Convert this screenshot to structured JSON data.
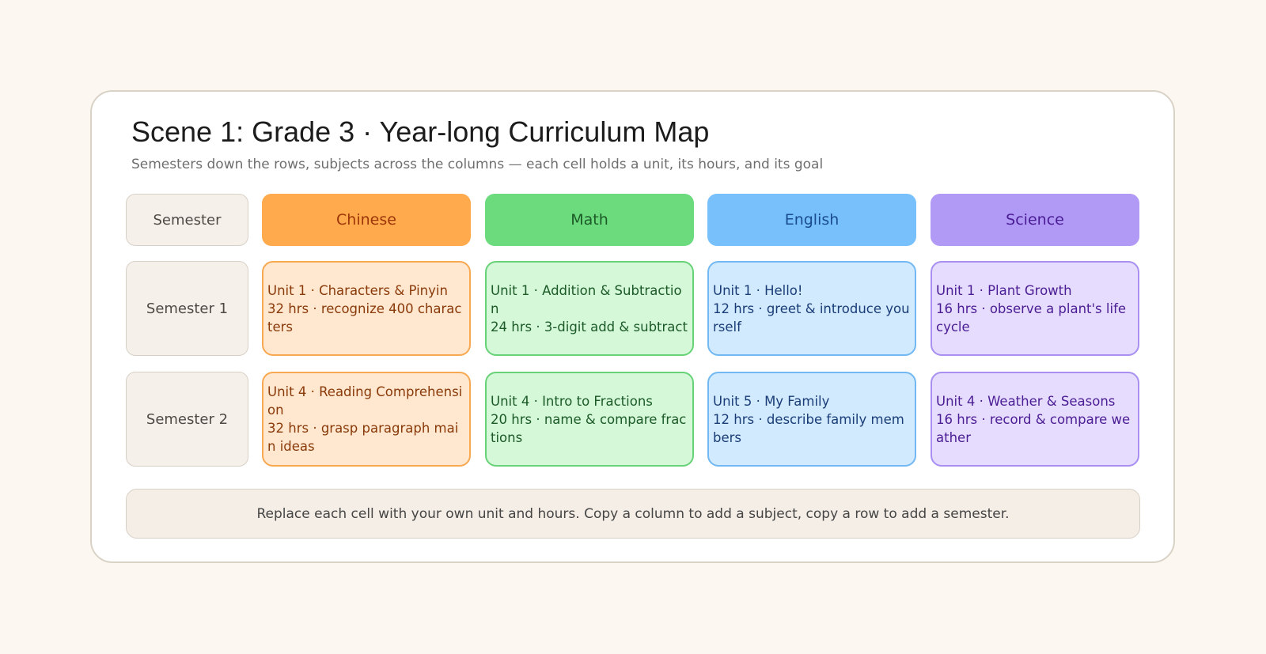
{
  "title": "Scene 1: Grade 3 · Year-long Curriculum Map",
  "subtitle": "Semesters down the rows, subjects across the columns — each cell holds a unit, its hours, and its goal",
  "corner_label": "Semester",
  "subjects": [
    {
      "name": "Chinese",
      "header_bg": "#ffaa4d",
      "header_text": "#9c3508",
      "cell_bg": "#ffe8cf",
      "cell_border": "#f7a851",
      "cell_text": "#8a3a0a"
    },
    {
      "name": "Math",
      "header_bg": "#6bdb7e",
      "header_text": "#1c5a27",
      "cell_bg": "#d5f8d9",
      "cell_border": "#67d277",
      "cell_text": "#1c5a27"
    },
    {
      "name": "English",
      "header_bg": "#78c0fb",
      "header_text": "#1a4d8f",
      "cell_bg": "#d2eafd",
      "cell_border": "#72b8f3",
      "cell_text": "#1a3d78"
    },
    {
      "name": "Science",
      "header_bg": "#b199f6",
      "header_text": "#4a1d94",
      "cell_bg": "#e6dcfd",
      "cell_border": "#a88ff0",
      "cell_text": "#4a1d94"
    }
  ],
  "semesters": [
    {
      "label": "Semester 1",
      "cells": [
        {
          "unit": "Unit 1 · Characters & Pinyin",
          "detail": "32 hrs · recognize 400 characters"
        },
        {
          "unit": "Unit 1 · Addition & Subtraction",
          "detail": "24 hrs · 3-digit add & subtract"
        },
        {
          "unit": "Unit 1 · Hello!",
          "detail": "12 hrs · greet & introduce yourself"
        },
        {
          "unit": "Unit 1 · Plant Growth",
          "detail": "16 hrs · observe a plant's life cycle"
        }
      ]
    },
    {
      "label": "Semester 2",
      "cells": [
        {
          "unit": "Unit 4 · Reading Comprehension",
          "detail": "32 hrs · grasp paragraph main ideas"
        },
        {
          "unit": "Unit 4 · Intro to Fractions",
          "detail": "20 hrs · name & compare fractions"
        },
        {
          "unit": "Unit 5 · My Family",
          "detail": "12 hrs · describe family members"
        },
        {
          "unit": "Unit 4 · Weather & Seasons",
          "detail": "16 hrs · record & compare weather"
        }
      ]
    }
  ],
  "footer_note": "Replace each cell with your own unit and hours. Copy a column to add a subject, copy a row to add a semester."
}
